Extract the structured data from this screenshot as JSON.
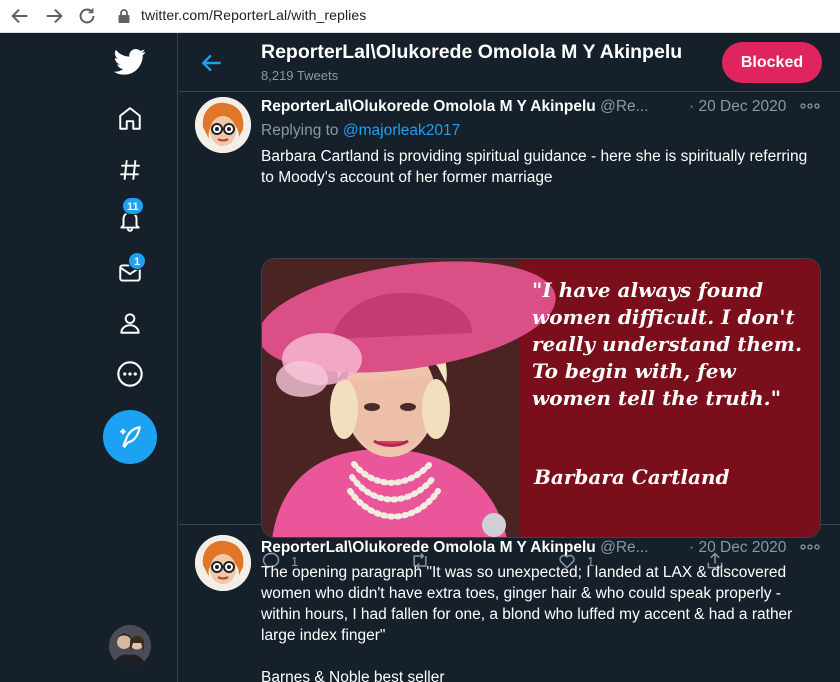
{
  "browser": {
    "url": "twitter.com/ReporterLal/with_replies"
  },
  "sidebar": {
    "notifications_badge": "11",
    "messages_badge": "1"
  },
  "header": {
    "name": "ReporterLal\\Olukorede Omolola M Y Akinpelu",
    "tweet_count": "8,219 Tweets",
    "blocked_label": "Blocked"
  },
  "tweets": [
    {
      "name": "ReporterLal\\Olukorede Omolola M Y Akinpelu",
      "handle": "@Re...",
      "date": "· 20 Dec 2020",
      "replying_prefix": "Replying to ",
      "replying_to": "@majorleak2017",
      "text": "Barbara Cartland is providing spiritual guidance - here she is spiritually referring to Moody's account of her former marriage",
      "media": {
        "quote": "\"I have always found women difficult. I don't really understand them. To begin with, few women tell the truth.\"",
        "author": "Barbara Cartland",
        "colors": {
          "panel": "#7a0f1b",
          "hat": "#d94f86",
          "dress": "#e9579a"
        }
      },
      "reply_count": "1",
      "retweet_count": "",
      "like_count": "1"
    },
    {
      "name": "ReporterLal\\Olukorede Omolola M Y Akinpelu",
      "handle": "@Re...",
      "date": "· 20 Dec 2020",
      "text": "The opening paragraph \"It was so unexpected; I landed at LAX & discovered women who didn't have extra toes, ginger hair & who could speak properly - within hours, I had fallen for one, a blond who luffed my accent & had a rather large index finger\"",
      "text2": "Barnes & Noble best seller"
    }
  ],
  "colors": {
    "background": "#15202b",
    "accent": "#1da1f2",
    "blocked": "#e0245e",
    "border": "#38444d",
    "muted": "#8899a6"
  }
}
